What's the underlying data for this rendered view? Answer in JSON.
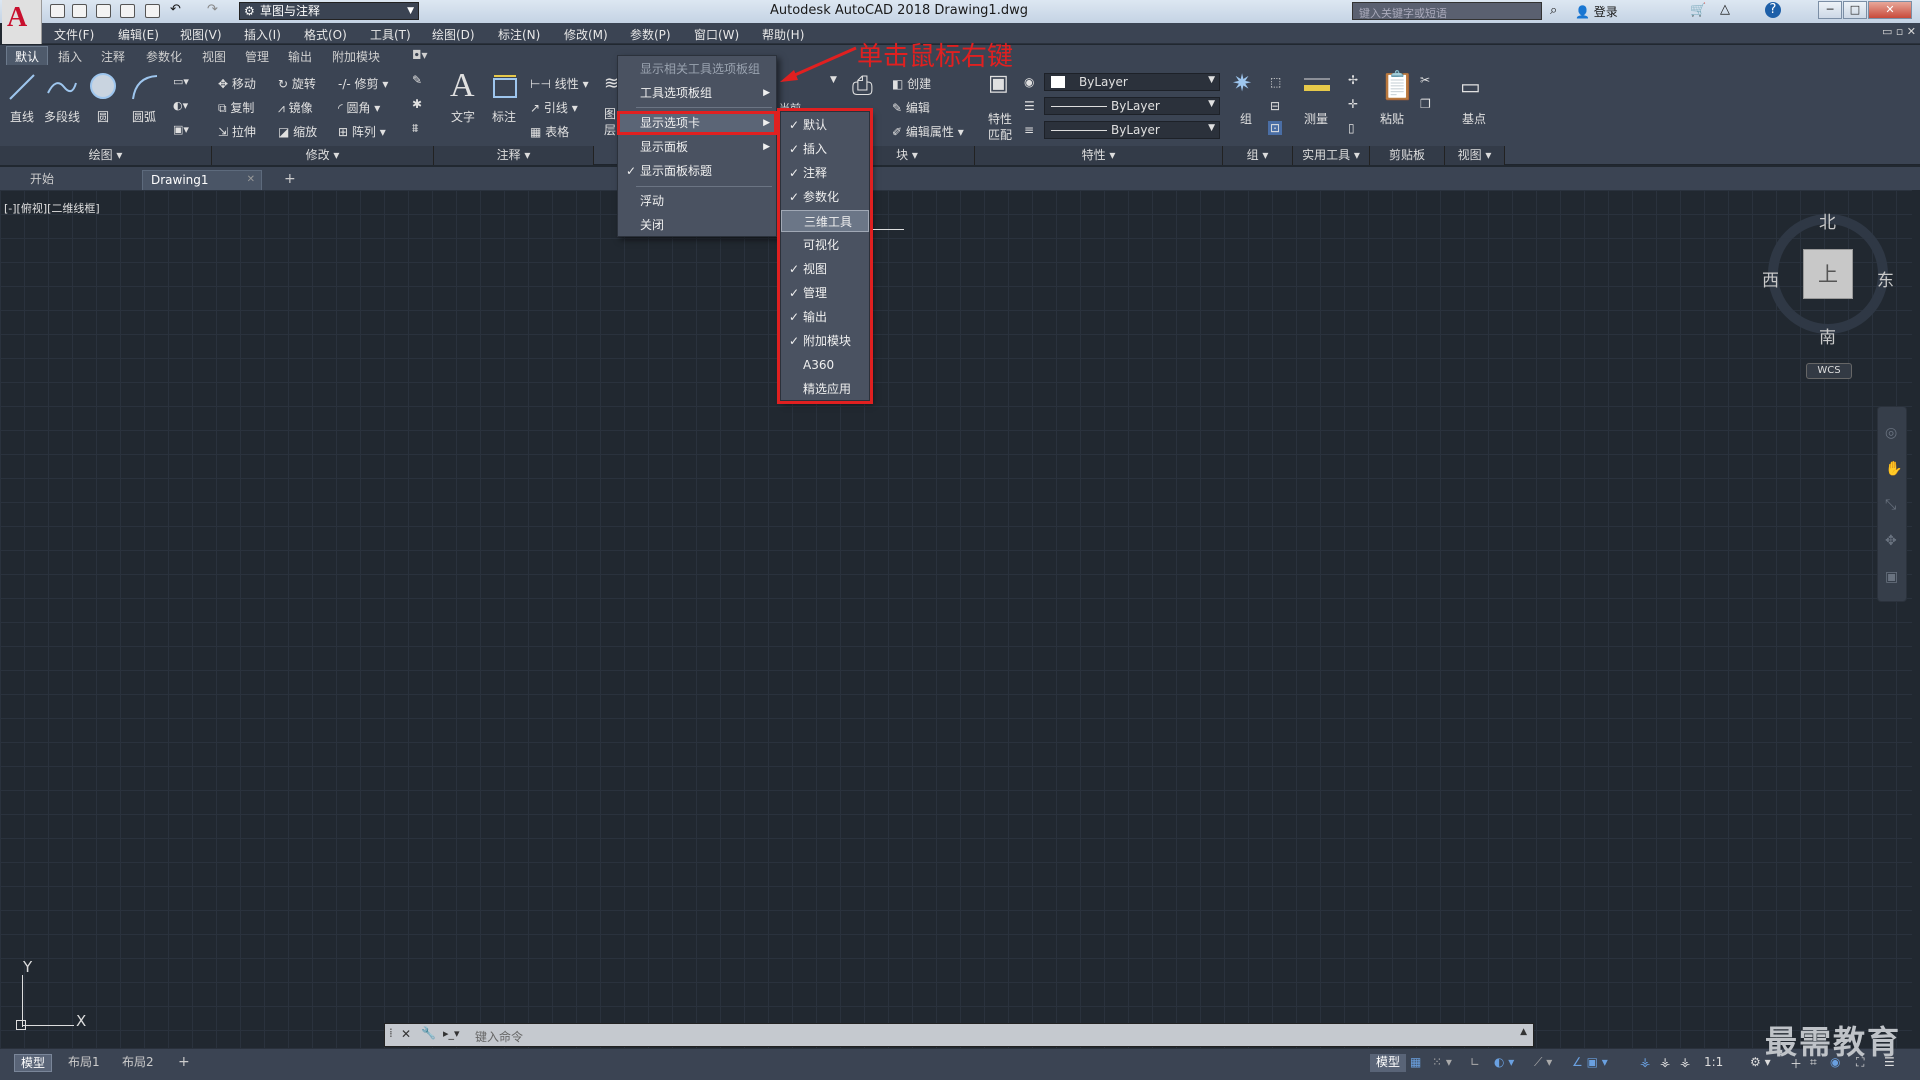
{
  "titlebar": {
    "logo_letter": "A",
    "workspace": "草图与注释",
    "title": "Autodesk AutoCAD 2018    Drawing1.dwg",
    "search_placeholder": "键入关键字或短语",
    "login": "登录",
    "win_min": "─",
    "win_max": "□",
    "win_close": "✕"
  },
  "menubar": [
    "文件(F)",
    "编辑(E)",
    "视图(V)",
    "插入(I)",
    "格式(O)",
    "工具(T)",
    "绘图(D)",
    "标注(N)",
    "修改(M)",
    "参数(P)",
    "窗口(W)",
    "帮助(H)"
  ],
  "ribbon_tabs": [
    "默认",
    "插入",
    "注释",
    "参数化",
    "视图",
    "管理",
    "输出",
    "附加模块"
  ],
  "ribbon": {
    "draw": {
      "line": "直线",
      "polyline": "多段线",
      "circle": "圆",
      "arc": "圆弧",
      "panel": "绘图 ▾"
    },
    "modify": {
      "move": "移动",
      "rotate": "旋转",
      "trim": "修剪",
      "copy": "复制",
      "mirror": "镜像",
      "fillet": "圆角",
      "stretch": "拉伸",
      "scale": "缩放",
      "array": "阵列",
      "panel": "修改 ▾"
    },
    "annotation": {
      "text": "文字",
      "dimension": "标注",
      "linear": "线性",
      "leader": "引线",
      "table": "表格",
      "panel": "注释 ▾"
    },
    "layers": {
      "current": "当前",
      "panel_short_1": "图",
      "panel_short_2": "层"
    },
    "block": {
      "create": "创建",
      "edit": "编辑",
      "edit_attr": "编辑属性",
      "panel": "块 ▾"
    },
    "properties": {
      "match_1": "特性",
      "match_2": "匹配",
      "bylayer_color": "ByLayer",
      "bylayer_linetype": "ByLayer",
      "bylayer_lineweight": "ByLayer",
      "panel": "特性 ▾"
    },
    "groups": {
      "group": "组",
      "panel": "组 ▾"
    },
    "utilities": {
      "measure": "测量",
      "panel": "实用工具 ▾"
    },
    "clipboard": {
      "paste": "粘贴",
      "panel": "剪贴板"
    },
    "view": {
      "base": "基点",
      "panel": "视图 ▾"
    }
  },
  "doc_tabs": {
    "start": "开始",
    "drawing": "Drawing1",
    "close": "✕",
    "add": "+"
  },
  "viewport_label": "[-][俯视][二维线框]",
  "viewcube": {
    "north": "北",
    "south": "南",
    "east": "东",
    "west": "西",
    "face": "上",
    "wcs": "WCS"
  },
  "ucs": {
    "x": "X",
    "y": "Y"
  },
  "command": {
    "placeholder": "键入命令"
  },
  "layout_tabs": [
    "模型",
    "布局1",
    "布局2",
    "+"
  ],
  "status": {
    "model": "模型",
    "scale": "1:1"
  },
  "watermark": "最需教育",
  "context_menu": {
    "items": [
      {
        "label": "显示相关工具选项板组",
        "disabled": true,
        "check": "",
        "arrow": ""
      },
      {
        "label": "工具选项板组",
        "disabled": false,
        "check": "",
        "arrow": "▶"
      },
      {
        "label": "显示选项卡",
        "disabled": false,
        "check": "",
        "arrow": "▶"
      },
      {
        "label": "显示面板",
        "disabled": false,
        "check": "",
        "arrow": "▶"
      },
      {
        "label": "显示面板标题",
        "disabled": false,
        "check": "✓",
        "arrow": ""
      },
      {
        "label": "浮动",
        "disabled": false,
        "check": "",
        "arrow": ""
      },
      {
        "label": "关闭",
        "disabled": false,
        "check": "",
        "arrow": ""
      }
    ]
  },
  "submenu": {
    "items": [
      {
        "label": "默认",
        "check": "✓"
      },
      {
        "label": "插入",
        "check": "✓"
      },
      {
        "label": "注释",
        "check": "✓"
      },
      {
        "label": "参数化",
        "check": "✓"
      },
      {
        "label": "三维工具",
        "check": ""
      },
      {
        "label": "可视化",
        "check": ""
      },
      {
        "label": "视图",
        "check": "✓"
      },
      {
        "label": "管理",
        "check": "✓"
      },
      {
        "label": "输出",
        "check": "✓"
      },
      {
        "label": "附加模块",
        "check": "✓"
      },
      {
        "label": "A360",
        "check": ""
      },
      {
        "label": "精选应用",
        "check": ""
      }
    ]
  },
  "annotation": "单击鼠标右键",
  "colors": {
    "highlight_red": "#e02020",
    "canvas": "#212830",
    "ribbon": "#3b4453"
  }
}
